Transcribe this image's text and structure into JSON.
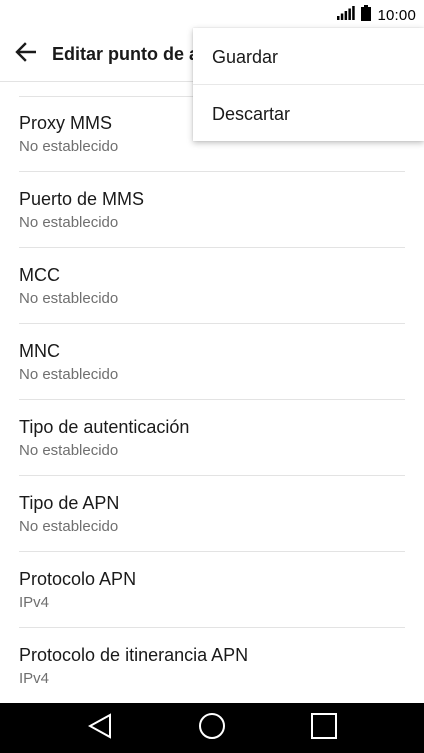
{
  "status_bar": {
    "time": "10:00",
    "signal_icon": "signal-bars-icon",
    "battery_icon": "battery-icon"
  },
  "app_bar": {
    "back_icon": "arrow-back-icon",
    "title": "Editar punto de a"
  },
  "overflow_menu": {
    "items": [
      {
        "label": "Guardar"
      },
      {
        "label": "Descartar"
      }
    ]
  },
  "settings": {
    "items": [
      {
        "title": "Proxy MMS",
        "value": "No establecido"
      },
      {
        "title": "Puerto de MMS",
        "value": "No establecido"
      },
      {
        "title": "MCC",
        "value": "No establecido"
      },
      {
        "title": "MNC",
        "value": "No establecido"
      },
      {
        "title": "Tipo de autenticación",
        "value": "No establecido"
      },
      {
        "title": "Tipo de APN",
        "value": "No establecido"
      },
      {
        "title": "Protocolo APN",
        "value": "IPv4"
      },
      {
        "title": "Protocolo de itinerancia APN",
        "value": "IPv4"
      }
    ]
  },
  "nav_bar": {
    "back_icon": "triangle-back-icon",
    "home_icon": "circle-home-icon",
    "recents_icon": "square-recents-icon"
  },
  "colors": {
    "text_primary": "#1a1a1a",
    "text_secondary": "#6f6f6f",
    "divider": "#e3e3e3",
    "nav_bar": "#000000"
  }
}
